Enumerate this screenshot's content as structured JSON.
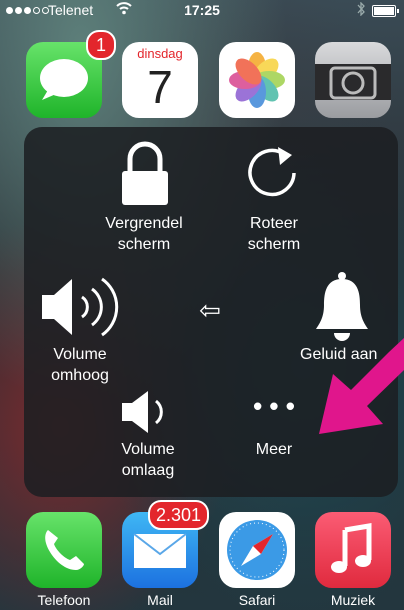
{
  "status_bar": {
    "carrier": "Telenet",
    "time": "17:25"
  },
  "top_apps": [
    {
      "name": "Berichten",
      "badge": "1"
    },
    {
      "name": "Agenda",
      "day_name": "dinsdag",
      "day_number": "7"
    },
    {
      "name": "Foto's"
    },
    {
      "name": "Camera"
    }
  ],
  "assistive_menu": {
    "lock": "Vergrendel scherm",
    "rotate": "Roteer scherm",
    "volume_up": "Volume omhoog",
    "mute": "Geluid aan",
    "volume_down": "Volume omlaag",
    "more": "Meer",
    "more_glyph": "• • •",
    "back_glyph": "⇦"
  },
  "dock_apps": [
    {
      "name": "Telefoon"
    },
    {
      "name": "Mail",
      "badge": "2.301"
    },
    {
      "name": "Safari"
    },
    {
      "name": "Muziek"
    }
  ],
  "colors": {
    "badge": "#e3262c",
    "arrow": "#e0168c",
    "panel": "#1c1e22"
  }
}
